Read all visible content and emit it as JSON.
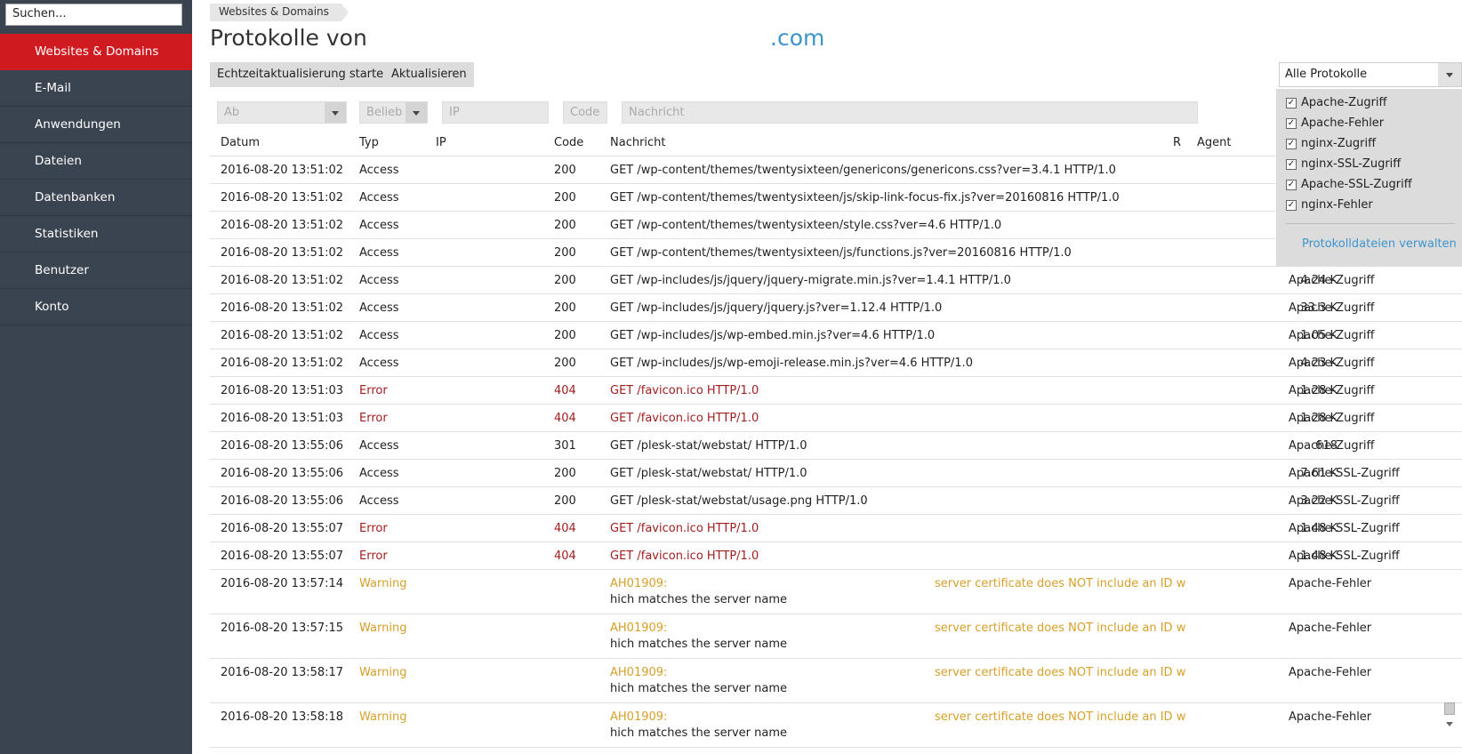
{
  "search": {
    "value": "Suchen..."
  },
  "nav": [
    {
      "label": "Websites & Domains",
      "active": true
    },
    {
      "label": "E-Mail"
    },
    {
      "label": "Anwendungen"
    },
    {
      "label": "Dateien"
    },
    {
      "label": "Datenbanken"
    },
    {
      "label": "Statistiken"
    },
    {
      "label": "Benutzer"
    },
    {
      "label": "Konto"
    }
  ],
  "breadcrumb": "Websites & Domains",
  "title": {
    "prefix": "Protokolle von",
    "domain": ".com"
  },
  "toolbar": {
    "live_label": "Echtzeitaktualisierung starten",
    "refresh_label": "Aktualisieren"
  },
  "log_select": {
    "value": "Alle Protokolle",
    "options": [
      {
        "label": "Apache-Zugriff",
        "checked": true
      },
      {
        "label": "Apache-Fehler",
        "checked": true
      },
      {
        "label": "nginx-Zugriff",
        "checked": true
      },
      {
        "label": "nginx-SSL-Zugriff",
        "checked": true
      },
      {
        "label": "Apache-SSL-Zugriff",
        "checked": true
      },
      {
        "label": "nginx-Fehler",
        "checked": true
      }
    ],
    "manage_label": "Protokolldateien verwalten"
  },
  "filters": {
    "ab": "Ab",
    "typ": "Belieb",
    "ip": "IP",
    "code": "Code",
    "msg": "Nachricht"
  },
  "columns": {
    "date": "Datum",
    "typ": "Typ",
    "ip": "IP",
    "code": "Code",
    "msg": "Nachricht",
    "r": "R",
    "agent": "Agent"
  },
  "rows": [
    {
      "date": "2016-08-20 13:51:02",
      "typ": "Access",
      "code": "200",
      "msg": "GET /wp-content/themes/twentysixteen/genericons/genericons.css?ver=3.4.1 HTTP/1.0",
      "size": "",
      "log": "",
      "kind": "access"
    },
    {
      "date": "2016-08-20 13:51:02",
      "typ": "Access",
      "code": "200",
      "msg": "GET /wp-content/themes/twentysixteen/js/skip-link-focus-fix.js?ver=20160816 HTTP/1.0",
      "size": "",
      "log": "",
      "kind": "access"
    },
    {
      "date": "2016-08-20 13:51:02",
      "typ": "Access",
      "code": "200",
      "msg": "GET /wp-content/themes/twentysixteen/style.css?ver=4.6 HTTP/1.0",
      "size": "",
      "log": "",
      "kind": "access"
    },
    {
      "date": "2016-08-20 13:51:02",
      "typ": "Access",
      "code": "200",
      "msg": "GET /wp-content/themes/twentysixteen/js/functions.js?ver=20160816 HTTP/1.0",
      "size": "",
      "log": "",
      "kind": "access"
    },
    {
      "date": "2016-08-20 13:51:02",
      "typ": "Access",
      "code": "200",
      "msg": "GET /wp-includes/js/jquery/jquery-migrate.min.js?ver=1.4.1 HTTP/1.0",
      "size": "4.24 K",
      "log": "Apache-Zugriff",
      "kind": "access"
    },
    {
      "date": "2016-08-20 13:51:02",
      "typ": "Access",
      "code": "200",
      "msg": "GET /wp-includes/js/jquery/jquery.js?ver=1.12.4 HTTP/1.0",
      "size": "33.3 K",
      "log": "Apache-Zugriff",
      "kind": "access"
    },
    {
      "date": "2016-08-20 13:51:02",
      "typ": "Access",
      "code": "200",
      "msg": "GET /wp-includes/js/wp-embed.min.js?ver=4.6 HTTP/1.0",
      "size": "1.05 K",
      "log": "Apache-Zugriff",
      "kind": "access"
    },
    {
      "date": "2016-08-20 13:51:02",
      "typ": "Access",
      "code": "200",
      "msg": "GET /wp-includes/js/wp-emoji-release.min.js?ver=4.6 HTTP/1.0",
      "size": "4.23 K",
      "log": "Apache-Zugriff",
      "kind": "access"
    },
    {
      "date": "2016-08-20 13:51:03",
      "typ": "Error",
      "code": "404",
      "msg": "GET /favicon.ico HTTP/1.0",
      "size": "1.28 K",
      "log": "Apache-Zugriff",
      "kind": "error"
    },
    {
      "date": "2016-08-20 13:51:03",
      "typ": "Error",
      "code": "404",
      "msg": "GET /favicon.ico HTTP/1.0",
      "size": "1.28 K",
      "log": "Apache-Zugriff",
      "kind": "error"
    },
    {
      "date": "2016-08-20 13:55:06",
      "typ": "Access",
      "code": "301",
      "msg": "GET /plesk-stat/webstat/ HTTP/1.0",
      "size": "618",
      "log": "Apache-Zugriff",
      "kind": "access"
    },
    {
      "date": "2016-08-20 13:55:06",
      "typ": "Access",
      "code": "200",
      "msg": "GET /plesk-stat/webstat/ HTTP/1.0",
      "size": "7.61 K",
      "log": "Apache-SSL-Zugriff",
      "kind": "access"
    },
    {
      "date": "2016-08-20 13:55:06",
      "typ": "Access",
      "code": "200",
      "msg": "GET /plesk-stat/webstat/usage.png HTTP/1.0",
      "size": "3.22 K",
      "log": "Apache-SSL-Zugriff",
      "kind": "access"
    },
    {
      "date": "2016-08-20 13:55:07",
      "typ": "Error",
      "code": "404",
      "msg": "GET /favicon.ico HTTP/1.0",
      "size": "1.48 K",
      "log": "Apache-SSL-Zugriff",
      "kind": "error"
    },
    {
      "date": "2016-08-20 13:55:07",
      "typ": "Error",
      "code": "404",
      "msg": "GET /favicon.ico HTTP/1.0",
      "size": "1.48 K",
      "log": "Apache-SSL-Zugriff",
      "kind": "error"
    },
    {
      "date": "2016-08-20 13:57:14",
      "typ": "Warning",
      "code": "",
      "msg": "AH01909:",
      "msg2": "server certificate does NOT include an ID w",
      "msg3": "hich matches the server name",
      "size": "",
      "log": "Apache-Fehler",
      "kind": "warning"
    },
    {
      "date": "2016-08-20 13:57:15",
      "typ": "Warning",
      "code": "",
      "msg": "AH01909:",
      "msg2": "server certificate does NOT include an ID w",
      "msg3": "hich matches the server name",
      "size": "",
      "log": "Apache-Fehler",
      "kind": "warning"
    },
    {
      "date": "2016-08-20 13:58:17",
      "typ": "Warning",
      "code": "",
      "msg": "AH01909:",
      "msg2": "server certificate does NOT include an ID w",
      "msg3": "hich matches the server name",
      "size": "",
      "log": "Apache-Fehler",
      "kind": "warning"
    },
    {
      "date": "2016-08-20 13:58:18",
      "typ": "Warning",
      "code": "",
      "msg": "AH01909:",
      "msg2": "server certificate does NOT include an ID w",
      "msg3": "hich matches the server name",
      "size": "",
      "log": "Apache-Fehler",
      "kind": "warning"
    }
  ]
}
